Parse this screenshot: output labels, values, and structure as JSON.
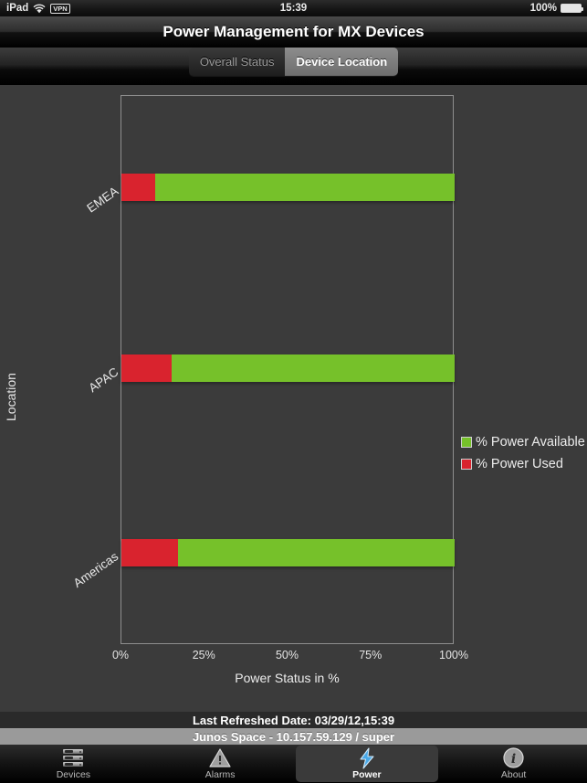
{
  "status_bar": {
    "carrier": "iPad",
    "wifi_icon": "wifi-icon",
    "vpn_badge": "VPN",
    "time": "15:39",
    "battery_percent": "100%",
    "battery_icon": "battery-full-icon"
  },
  "header": {
    "title": "Power Management for MX Devices"
  },
  "segmented_control": {
    "options": [
      {
        "label": "Overall Status",
        "selected": false
      },
      {
        "label": "Device Location",
        "selected": true
      }
    ]
  },
  "chart_data": {
    "type": "bar",
    "orientation": "horizontal",
    "stacked": true,
    "title": "",
    "xlabel": "Power Status in %",
    "ylabel": "Location",
    "categories": [
      "EMEA",
      "APAC",
      "Americas"
    ],
    "series": [
      {
        "name": "% Power Used",
        "color": "#d9232e",
        "values": [
          10,
          15,
          17
        ]
      },
      {
        "name": "% Power Available",
        "color": "#76c12a",
        "values": [
          90,
          85,
          83
        ]
      }
    ],
    "xlim": [
      0,
      100
    ],
    "xticks": [
      "0%",
      "25%",
      "50%",
      "75%",
      "100%"
    ],
    "xtick_values": [
      0,
      25,
      50,
      75,
      100
    ],
    "grid": false,
    "legend_position": "right",
    "legend": [
      "% Power Available",
      "% Power Used"
    ],
    "background": "#3b3b3b"
  },
  "footer": {
    "last_refreshed": "Last Refreshed Date: 03/29/12,15:39",
    "server_info": "Junos Space - 10.157.59.129 / super"
  },
  "tab_bar": {
    "items": [
      {
        "label": "Devices",
        "icon": "server-rack-icon",
        "selected": false
      },
      {
        "label": "Alarms",
        "icon": "warning-triangle-icon",
        "selected": false
      },
      {
        "label": "Power",
        "icon": "lightning-bolt-icon",
        "selected": true
      },
      {
        "label": "About",
        "icon": "info-circle-icon",
        "selected": false
      }
    ]
  }
}
